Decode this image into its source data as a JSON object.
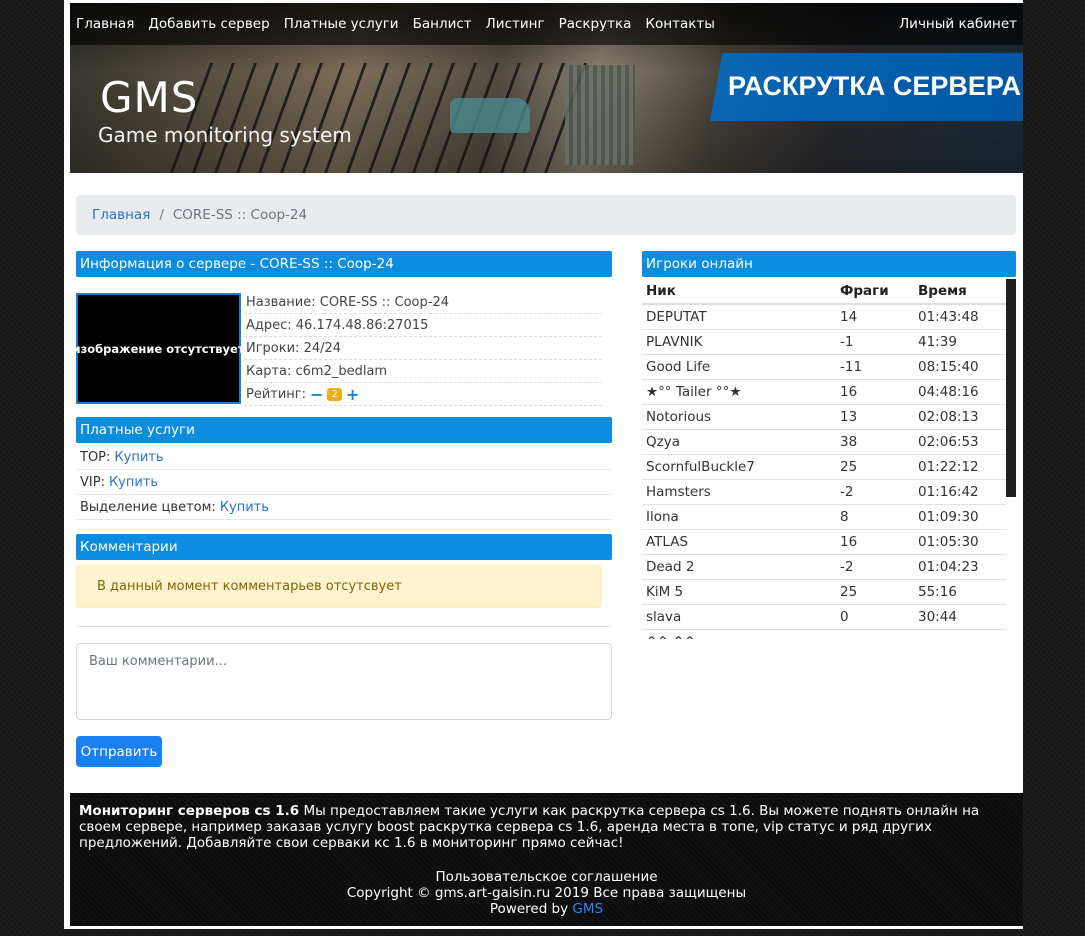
{
  "nav": {
    "items": [
      "Главная",
      "Добавить сервер",
      "Платные услуги",
      "Банлист",
      "Листинг",
      "Раскрутка",
      "Контакты"
    ],
    "account": "Личный кабинет"
  },
  "banner": {
    "logo": "GMS",
    "tagline": "Game monitoring system",
    "promo": "РАСКРУТКА СЕРВЕРА"
  },
  "breadcrumb": {
    "home": "Главная",
    "separator": "/",
    "current": "CORE-SS :: Coop-24"
  },
  "server_info": {
    "heading": "Информация о сервере - CORE-SS :: Coop-24",
    "image_placeholder": "изображение отсутствует",
    "name": "Название: CORE-SS :: Coop-24",
    "address": "Адрес: 46.174.48.86:27015",
    "players": "Игроки: 24/24",
    "map": "Карта: c6m2_bedlam",
    "rating_label": "Рейтинг:",
    "rating_minus": "−",
    "rating_value": "2",
    "rating_plus": "+"
  },
  "paid": {
    "heading": "Платные услуги",
    "items": [
      {
        "label": "TOP:",
        "link": "Купить"
      },
      {
        "label": "VIP:",
        "link": "Купить"
      },
      {
        "label": "Выделение цветом:",
        "link": "Купить"
      }
    ]
  },
  "comments": {
    "heading": "Комментарии",
    "empty": "В данный момент комментарьев отсутсвует",
    "placeholder": "Ваш комментарии...",
    "submit": "Отправить"
  },
  "players": {
    "heading": "Игроки онлайн",
    "columns": [
      "Ник",
      "Фраги",
      "Время"
    ],
    "rows": [
      [
        "DEPUTAT",
        "14",
        "01:43:48"
      ],
      [
        "PLAVNIK",
        "-1",
        "41:39"
      ],
      [
        "Good Life",
        "-11",
        "08:15:40"
      ],
      [
        "★°° Tailer °°★",
        "16",
        "04:48:16"
      ],
      [
        "Notorious",
        "13",
        "02:08:13"
      ],
      [
        "Qzya",
        "38",
        "02:06:53"
      ],
      [
        "ScornfulBuckle7",
        "25",
        "01:22:12"
      ],
      [
        "Hamsters",
        "-2",
        "01:16:42"
      ],
      [
        "Ilona",
        "8",
        "01:09:30"
      ],
      [
        "ATLAS",
        "16",
        "01:05:30"
      ],
      [
        "Dead 2",
        "-2",
        "01:04:23"
      ],
      [
        "KiM 5",
        "25",
        "55:16"
      ],
      [
        "slava",
        "0",
        "30:44"
      ],
      [
        "^^ ^^",
        "",
        ""
      ]
    ]
  },
  "footer": {
    "about_bold": "Мониторинг серверов cs 1.6",
    "about_text": " Мы предоставляем такие услуги как раскрутка сервера cs 1.6. Вы можете поднять онлайн на своем сервере, например заказав услугу boost раскрутка сервера cs 1.6, аренда места в топе, vip статус и ряд других предложений. Добавляйте свои серваки кс 1.6 в мониторинг прямо сейчас!",
    "agreement": "Пользовательское соглашение",
    "copyright": "Copyright © gms.art-gaisin.ru 2019 Все права защищены",
    "powered_prefix": "Powered by ",
    "powered_link": "GMS"
  }
}
